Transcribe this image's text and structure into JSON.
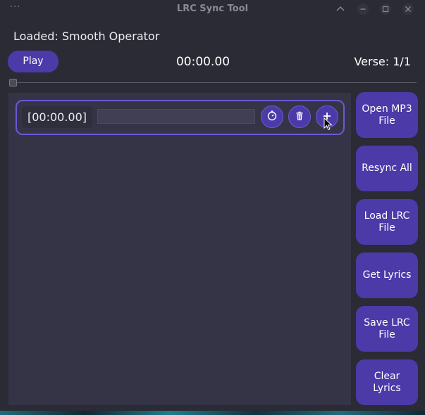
{
  "window": {
    "title": "LRC Sync Tool",
    "menu_glyph": "···"
  },
  "status": {
    "loaded_text": "Loaded: Smooth Operator"
  },
  "transport": {
    "play_label": "Play",
    "time": "00:00.00",
    "verse": "Verse: 1/1",
    "progress": 0
  },
  "lyrics": {
    "rows": [
      {
        "timestamp": "[00:00.00]",
        "text": ""
      }
    ]
  },
  "sidebar": {
    "buttons": [
      {
        "label": "Open MP3 File"
      },
      {
        "label": "Resync All"
      },
      {
        "label": "Load LRC File"
      },
      {
        "label": "Get Lyrics"
      },
      {
        "label": "Save LRC File"
      },
      {
        "label": "Clear Lyrics"
      }
    ]
  },
  "icons": {
    "row_actions": [
      "stopwatch-icon",
      "trash-icon",
      "plus-icon"
    ],
    "window_controls": [
      "chevron-up-icon",
      "minimize-icon",
      "maximize-icon",
      "close-icon"
    ]
  },
  "colors": {
    "accent": "#4b3aa8",
    "row_border": "#6c57d6",
    "panel": "#353447",
    "window_bg": "#2b2b35"
  }
}
